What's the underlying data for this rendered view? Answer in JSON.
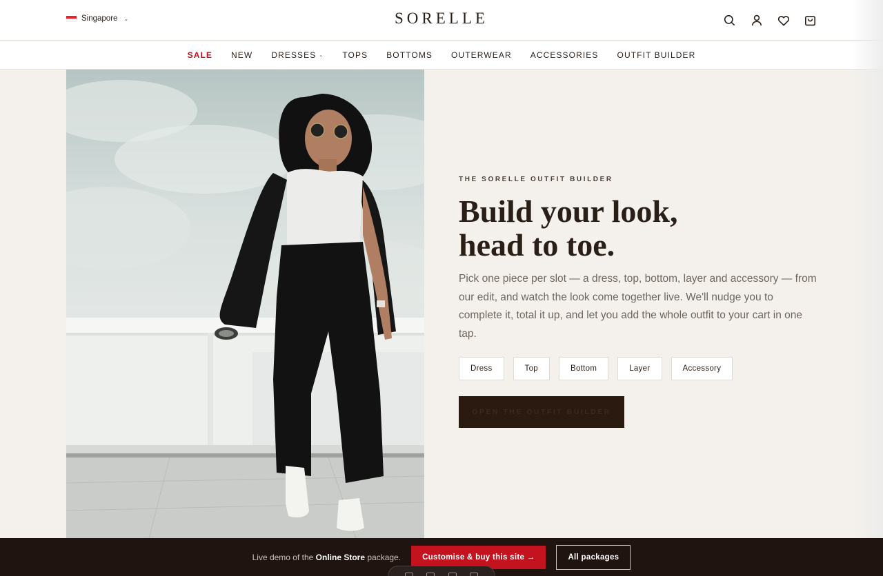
{
  "header": {
    "region": {
      "label": "Singapore",
      "flag_colors": [
        "#e4202d",
        "#f6f6f6"
      ]
    },
    "logo": "SORELLE",
    "icons": [
      "search-icon",
      "account-icon",
      "wishlist-heart-icon",
      "cart-bag-icon"
    ]
  },
  "nav": {
    "items": [
      {
        "label": "SALE",
        "highlight": true,
        "color": "#c3131f"
      },
      {
        "label": "NEW"
      },
      {
        "label": "DRESSES",
        "has_dropdown": true
      },
      {
        "label": "TOPS"
      },
      {
        "label": "BOTTOMS"
      },
      {
        "label": "OUTERWEAR"
      },
      {
        "label": "ACCESSORIES"
      },
      {
        "label": "OUTFIT BUILDER"
      }
    ]
  },
  "hero": {
    "image_alt": "Woman in sunglasses wearing a white tee, black blazer draped on shoulders, wide black trousers and white sneakers on a rooftop",
    "eyebrow": "THE SORELLE OUTFIT BUILDER",
    "headline": [
      "Build your look,",
      "head to toe."
    ],
    "description": "Pick one piece per slot — a dress, top, bottom, layer and accessory — from our edit, and watch the look come together live. We'll nudge you to complete it, total it up, and let you add the whole outfit to your cart in one tap.",
    "chips": [
      "Dress",
      "Top",
      "Bottom",
      "Layer",
      "Accessory"
    ],
    "cta": "OPEN THE OUTFIT BUILDER"
  },
  "demo_bar": {
    "text_prefix": "Live demo of the ",
    "text_bold": "Online Store",
    "text_suffix": " package.",
    "buy_button": "Customise & buy this site →",
    "all_button": "All packages"
  },
  "colors": {
    "accent_red": "#c3131f",
    "dark_brown": "#2a1a10",
    "page_bg": "#f4f1ec",
    "bar_bg": "#1f1410"
  }
}
